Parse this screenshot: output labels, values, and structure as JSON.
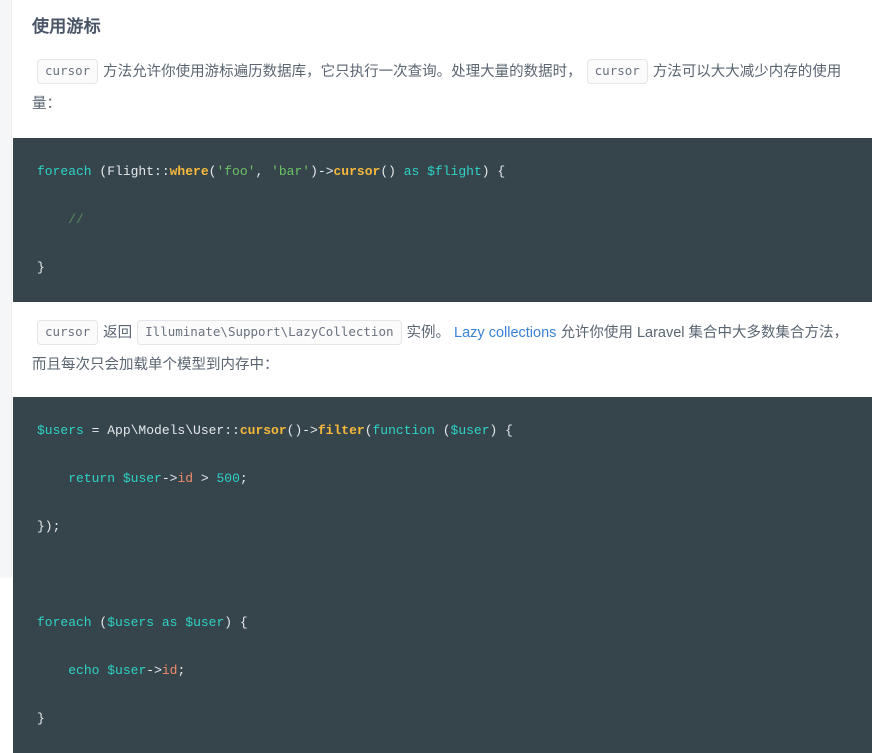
{
  "theme": {
    "page_bg": "#ffffff",
    "rail_bg": "#f5f6f8",
    "text_color": "#5b6572",
    "heading_color": "#4a5568",
    "link_color": "#3b82d6",
    "code_bg": "#36454c",
    "code_fg": "#e8eaed",
    "inline_code_bg": "#fbfbfc",
    "inline_code_border": "#e3e5e8",
    "token_keyword": "#2ed3c6",
    "token_function": "#f6b93b",
    "token_string": "#6cc364",
    "token_comment": "#5c8a62",
    "token_number": "#2ed3c6",
    "token_property": "#f08a6c"
  },
  "heading": {
    "text": "使用游标"
  },
  "paragraph_1": {
    "code_1": "cursor",
    "text_1": "方法允许你使用游标遍历数据库，它只执行一次查询。处理大量的数据时，",
    "code_2": "cursor",
    "text_2": "方法可以大大减少内存的使用量："
  },
  "paragraph_2": {
    "code_1": "cursor",
    "text_1": "返回",
    "code_2": "Illuminate\\Support\\LazyCollection",
    "text_2": "实例。",
    "link_text": "Lazy collections",
    "text_3": "允许你使用 Laravel 集合中大多数集合方法，而且每次只会加载单个模型到内存中："
  },
  "code_block_1": {
    "language": "php",
    "lines": [
      [
        {
          "t": "foreach",
          "c": "kw"
        },
        {
          "t": " (Flight::",
          "c": "plain"
        },
        {
          "t": "where",
          "c": "fn-b"
        },
        {
          "t": "(",
          "c": "plain"
        },
        {
          "t": "'foo'",
          "c": "str"
        },
        {
          "t": ", ",
          "c": "plain"
        },
        {
          "t": "'bar'",
          "c": "str"
        },
        {
          "t": ")->",
          "c": "plain"
        },
        {
          "t": "cursor",
          "c": "fn-b"
        },
        {
          "t": "() ",
          "c": "plain"
        },
        {
          "t": "as",
          "c": "kw"
        },
        {
          "t": " ",
          "c": "plain"
        },
        {
          "t": "$flight",
          "c": "var"
        },
        {
          "t": ") {",
          "c": "plain"
        }
      ],
      [
        {
          "t": "    ",
          "c": "plain"
        },
        {
          "t": "//",
          "c": "comment"
        }
      ],
      [
        {
          "t": "}",
          "c": "plain"
        }
      ]
    ]
  },
  "code_block_2": {
    "language": "php",
    "lines": [
      [
        {
          "t": "$users",
          "c": "var"
        },
        {
          "t": " = App\\Models\\User::",
          "c": "plain"
        },
        {
          "t": "cursor",
          "c": "fn-b"
        },
        {
          "t": "()->",
          "c": "plain"
        },
        {
          "t": "filter",
          "c": "fn-b"
        },
        {
          "t": "(",
          "c": "plain"
        },
        {
          "t": "function",
          "c": "kw"
        },
        {
          "t": " (",
          "c": "plain"
        },
        {
          "t": "$user",
          "c": "var"
        },
        {
          "t": ") {",
          "c": "plain"
        }
      ],
      [
        {
          "t": "    ",
          "c": "plain"
        },
        {
          "t": "return",
          "c": "kw"
        },
        {
          "t": " ",
          "c": "plain"
        },
        {
          "t": "$user",
          "c": "var"
        },
        {
          "t": "->",
          "c": "plain"
        },
        {
          "t": "id",
          "c": "prop"
        },
        {
          "t": " > ",
          "c": "plain"
        },
        {
          "t": "500",
          "c": "num"
        },
        {
          "t": ";",
          "c": "plain"
        }
      ],
      [
        {
          "t": "});",
          "c": "plain"
        }
      ],
      [],
      [
        {
          "t": "foreach",
          "c": "kw"
        },
        {
          "t": " (",
          "c": "plain"
        },
        {
          "t": "$users",
          "c": "var"
        },
        {
          "t": " ",
          "c": "plain"
        },
        {
          "t": "as",
          "c": "kw"
        },
        {
          "t": " ",
          "c": "plain"
        },
        {
          "t": "$user",
          "c": "var"
        },
        {
          "t": ") {",
          "c": "plain"
        }
      ],
      [
        {
          "t": "    ",
          "c": "plain"
        },
        {
          "t": "echo",
          "c": "kw"
        },
        {
          "t": " ",
          "c": "plain"
        },
        {
          "t": "$user",
          "c": "var"
        },
        {
          "t": "->",
          "c": "plain"
        },
        {
          "t": "id",
          "c": "prop"
        },
        {
          "t": ";",
          "c": "plain"
        }
      ],
      [
        {
          "t": "}",
          "c": "plain"
        }
      ]
    ]
  }
}
